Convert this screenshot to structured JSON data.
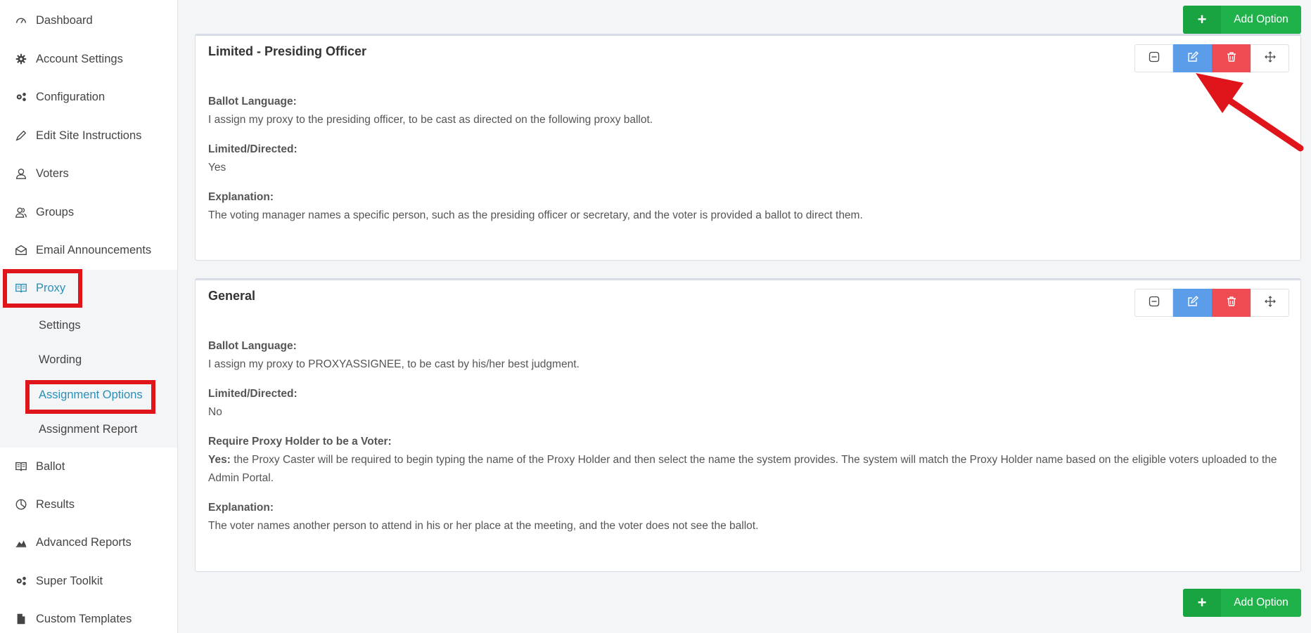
{
  "sidebar": {
    "items": [
      {
        "label": "Dashboard",
        "icon": "dashboard-icon"
      },
      {
        "label": "Account Settings",
        "icon": "gear-icon"
      },
      {
        "label": "Configuration",
        "icon": "gears-icon"
      },
      {
        "label": "Edit Site Instructions",
        "icon": "pencil-icon"
      },
      {
        "label": "Voters",
        "icon": "user-icon"
      },
      {
        "label": "Groups",
        "icon": "users-icon"
      },
      {
        "label": "Email Announcements",
        "icon": "envelope-icon"
      },
      {
        "label": "Proxy",
        "icon": "book-icon"
      },
      {
        "label": "Ballot",
        "icon": "book-icon"
      },
      {
        "label": "Results",
        "icon": "pie-chart-icon"
      },
      {
        "label": "Advanced Reports",
        "icon": "area-chart-icon"
      },
      {
        "label": "Super Toolkit",
        "icon": "gears-icon"
      },
      {
        "label": "Custom Templates",
        "icon": "file-icon"
      }
    ],
    "proxy_sub": [
      {
        "label": "Settings"
      },
      {
        "label": "Wording"
      },
      {
        "label": "Assignment Options"
      },
      {
        "label": "Assignment Report"
      }
    ]
  },
  "main": {
    "add_option_label": "Add Option",
    "cards": [
      {
        "title": "Limited - Presiding Officer",
        "fields": [
          {
            "label": "Ballot Language:",
            "value": "I assign my proxy to the presiding officer, to be cast as directed on the following proxy ballot."
          },
          {
            "label": "Limited/Directed:",
            "value": "Yes"
          },
          {
            "label": "Explanation:",
            "value": "The voting manager names a specific person, such as the presiding officer or secretary, and the voter is provided a ballot to direct them."
          }
        ]
      },
      {
        "title": "General",
        "fields": [
          {
            "label": "Ballot Language:",
            "value": "I assign my proxy to PROXYASSIGNEE, to be cast by his/her best judgment."
          },
          {
            "label": "Limited/Directed:",
            "value": "No"
          },
          {
            "label": "Require Proxy Holder to be a Voter:",
            "value_bold": "Yes:",
            "value": " the Proxy Caster will be required to begin typing the name of the Proxy Holder and then select the name the system provides. The system will match the Proxy Holder name based on the eligible voters uploaded to the Admin Portal."
          },
          {
            "label": "Explanation:",
            "value": "The voter names another person to attend in his or her place at the meeting, and the voter does not see the ballot."
          }
        ]
      }
    ]
  },
  "colors": {
    "accent": "#2a8fb8",
    "success": "#1fb14a",
    "edit": "#5b9de8",
    "danger": "#ef4b52",
    "highlight": "#e0151b"
  }
}
